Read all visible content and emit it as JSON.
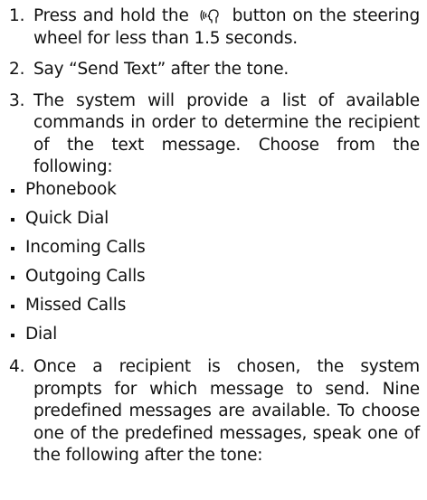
{
  "steps": [
    {
      "num": "1.",
      "before_icon": "Press and hold the",
      "icon": "voice-command-icon",
      "after_icon": "button on the steering wheel for less than 1.5 seconds."
    },
    {
      "num": "2.",
      "text": "Say “Send Text” after the tone."
    },
    {
      "num": "3.",
      "text": "The system will provide a list of available commands in order to determine the recipient of the text message. Choose from the following:"
    },
    {
      "num": "4.",
      "text": "Once a recipient is chosen, the system prompts for which message to send. Nine predefined messages are available. To choose one of the predefined messages, speak one of the following after the tone:"
    }
  ],
  "commands": [
    "Phonebook",
    "Quick Dial",
    "Incoming Calls",
    "Outgoing Calls",
    "Missed Calls",
    "Dial"
  ]
}
